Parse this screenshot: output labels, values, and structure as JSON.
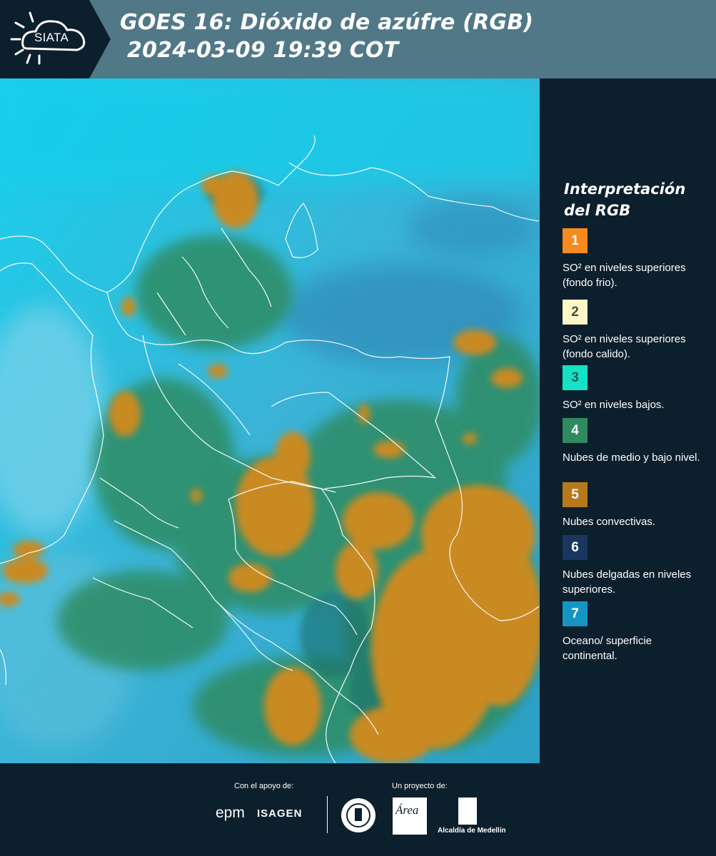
{
  "header": {
    "title_line1": "GOES 16: Dióxido de azúfre (RGB)",
    "title_line2": "2024-03-09 19:39 COT",
    "logo_text": "SIATA"
  },
  "colors": {
    "header_bg": "#507887",
    "panel_bg": "#0c1f2c",
    "map_sky": "#15c6e6",
    "map_ocean": "#3aa7cf",
    "map_green": "#2e8c63",
    "map_orange": "#c98a21",
    "boundary_line": "#ffffff"
  },
  "legend": {
    "title": "Interpretación del RGB",
    "items": [
      {
        "number": "1",
        "label": "SO² en niveles superiores (fondo frio).",
        "color": "#f68a1e",
        "text_color": "#ffffff"
      },
      {
        "number": "2",
        "label": "SO² en niveles superiores (fondo calido).",
        "color": "#fff6c7",
        "text_color": "#4a4a4a"
      },
      {
        "number": "3",
        "label": "SO² en niveles bajos.",
        "color": "#14e2c6",
        "text_color": "#1b5e57"
      },
      {
        "number": "4",
        "label": "Nubes de medio y bajo nivel.",
        "color": "#2f8a5f",
        "text_color": "#ffffff"
      },
      {
        "number": "5",
        "label": "Nubes convectivas.",
        "color": "#b8781c",
        "text_color": "#ffffff"
      },
      {
        "number": "6",
        "label": "Nubes delgadas en niveles superiores.",
        "color": "#18365f",
        "text_color": "#ffffff"
      },
      {
        "number": "7",
        "label": "Oceano/ superficie continental.",
        "color": "#1595c4",
        "text_color": "#ffffff"
      }
    ]
  },
  "footer": {
    "support_label": "Con el apoyo de:",
    "project_label": "Un proyecto de:",
    "epm": "epm",
    "isagen": "ISAGEN",
    "area": "Área",
    "alcaldia": "Alcaldía de Medellín"
  }
}
